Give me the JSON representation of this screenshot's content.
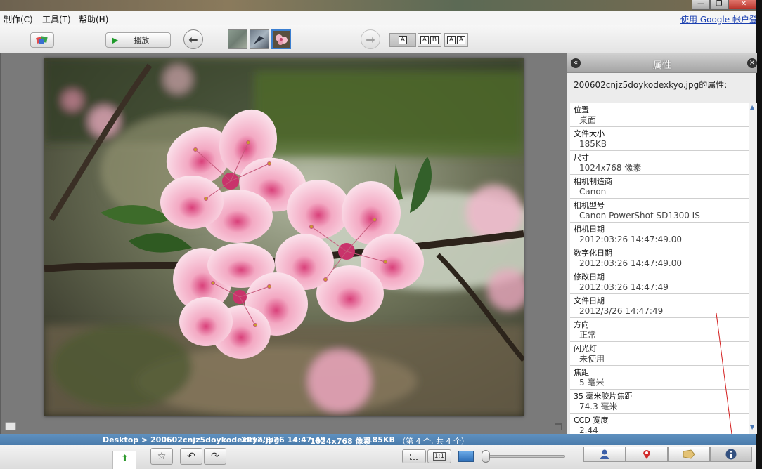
{
  "menu": {
    "items": [
      "制作(C)",
      "工具(T)",
      "帮助(H)"
    ],
    "sign_in": "使用 Google 帐户登录"
  },
  "window_controls": {
    "minimize": "—",
    "restore": "❐",
    "close": "✕"
  },
  "toolbar": {
    "play_label": "播放",
    "layout_buttons": [
      {
        "letters": [
          "A"
        ]
      },
      {
        "letters": [
          "A",
          "B"
        ]
      },
      {
        "letters": [
          "A",
          "A"
        ]
      }
    ]
  },
  "properties": {
    "title": "属性",
    "filename_line": "200602cnjz5doykodexkyo.jpg的属性:",
    "rows": [
      {
        "key": "位置",
        "value": "桌面"
      },
      {
        "key": "文件大小",
        "value": "185KB"
      },
      {
        "key": "尺寸",
        "value": "1024x768 像素"
      },
      {
        "key": "相机制造商",
        "value": "Canon"
      },
      {
        "key": "相机型号",
        "value": "Canon PowerShot SD1300 IS"
      },
      {
        "key": "相机日期",
        "value": "2012:03:26 14:47:49.00"
      },
      {
        "key": "数字化日期",
        "value": "2012:03:26 14:47:49.00"
      },
      {
        "key": "修改日期",
        "value": "2012:03:26 14:47:49"
      },
      {
        "key": "文件日期",
        "value": "2012/3/26 14:47:49"
      },
      {
        "key": "方向",
        "value": "正常"
      },
      {
        "key": "闪光灯",
        "value": "未使用"
      },
      {
        "key": "焦距",
        "value": "5 毫米"
      },
      {
        "key": "35 毫米胶片焦距",
        "value": "74.3 毫米"
      },
      {
        "key": "CCD 宽度",
        "value": "2.44"
      }
    ]
  },
  "status": {
    "path": "Desktop > 200602cnjz5doykodexkyo.jpg",
    "datetime": "2012/3/26 14:47:49",
    "dimensions": "1024x768 像素",
    "size": "185KB",
    "position": "（第 4 个, 共 4 个）"
  },
  "bottom": {
    "actual_size_label": "1:1",
    "zoom_level": 0.0
  },
  "colors": {
    "status_bar": "#4f80b0",
    "viewer_bg": "#7a7a7a",
    "link": "#1a3fb0"
  }
}
